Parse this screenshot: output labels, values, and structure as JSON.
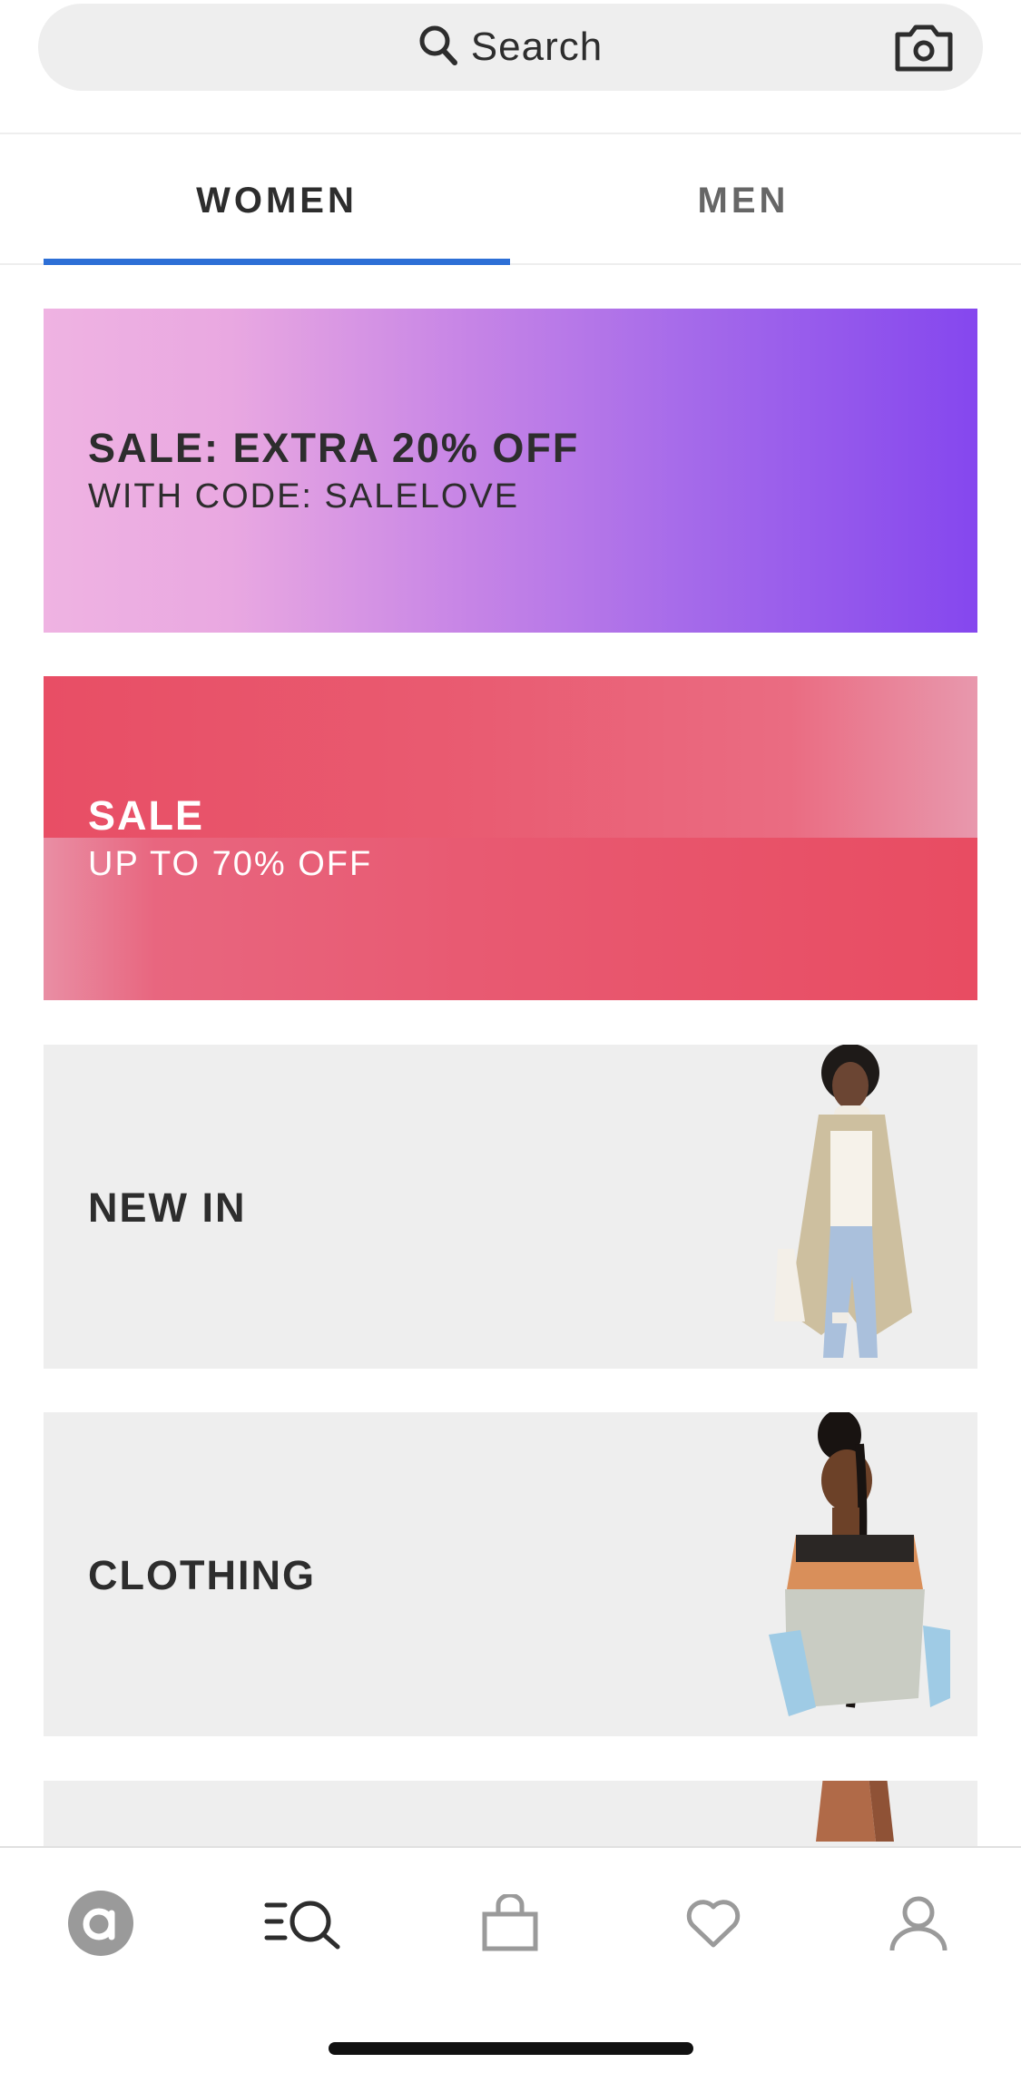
{
  "search": {
    "placeholder": "Search",
    "icons": [
      "search-icon",
      "camera-icon"
    ]
  },
  "tabs": [
    {
      "label": "WOMEN",
      "active": true
    },
    {
      "label": "MEN",
      "active": false
    }
  ],
  "accent_color": "#2d6fd6",
  "banners": [
    {
      "title": "SALE: EXTRA 20% OFF",
      "subtitle": "WITH CODE: SALELOVE"
    },
    {
      "title": "SALE",
      "subtitle": "UP TO 70% OFF"
    },
    {
      "title": "NEW IN"
    },
    {
      "title": "CLOTHING"
    }
  ],
  "bottom_nav": [
    {
      "icon": "asos-logo-icon",
      "active": false
    },
    {
      "icon": "browse-search-icon",
      "active": true
    },
    {
      "icon": "bag-icon",
      "active": false
    },
    {
      "icon": "heart-icon",
      "active": false
    },
    {
      "icon": "account-icon",
      "active": false
    }
  ]
}
